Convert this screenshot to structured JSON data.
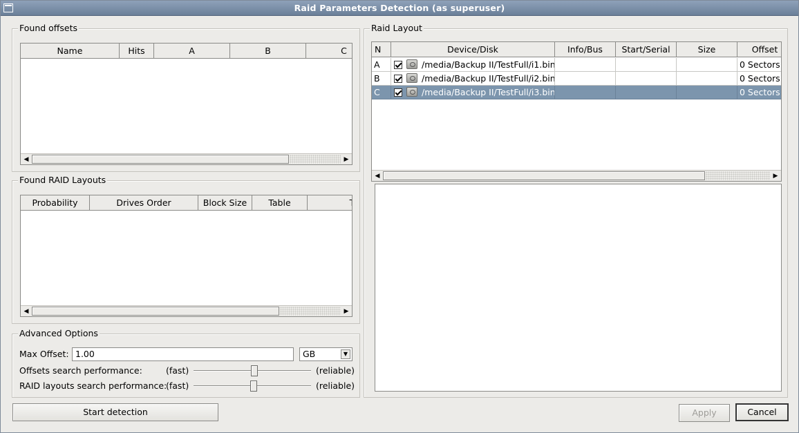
{
  "window": {
    "title": "Raid Parameters Detection (as superuser)"
  },
  "found_offsets": {
    "title": "Found offsets",
    "columns": [
      "Name",
      "Hits",
      "A",
      "B",
      "C"
    ]
  },
  "found_layouts": {
    "title": "Found RAID Layouts",
    "columns": [
      "Probability",
      "Drives Order",
      "Block Size",
      "Table",
      "T"
    ]
  },
  "advanced": {
    "title": "Advanced Options",
    "max_offset_label": "Max Offset:",
    "max_offset_value": "1.00",
    "unit": "GB",
    "offsets_perf_label": "Offsets search performance:",
    "layouts_perf_label": "RAID layouts search performance:",
    "fast_label": "(fast)",
    "reliable_label": "(reliable)",
    "offsets_perf_level": 0.52,
    "layouts_perf_level": 0.51
  },
  "raid_layout": {
    "title": "Raid Layout",
    "columns": [
      "N",
      "Device/Disk",
      "Info/Bus",
      "Start/Serial",
      "Size",
      "Offset"
    ],
    "rows": [
      {
        "n": "A",
        "checked": true,
        "device": "/media/Backup II/TestFull/i1.bin",
        "info": "",
        "start": "",
        "size": "",
        "offset": "0 Sectors",
        "selected": false
      },
      {
        "n": "B",
        "checked": true,
        "device": "/media/Backup II/TestFull/i2.bin",
        "info": "",
        "start": "",
        "size": "",
        "offset": "0 Sectors",
        "selected": false
      },
      {
        "n": "C",
        "checked": true,
        "device": "/media/Backup II/TestFull/i3.bin",
        "info": "",
        "start": "",
        "size": "",
        "offset": "0 Sectors",
        "selected": true
      }
    ]
  },
  "buttons": {
    "start_detection": "Start detection",
    "apply": "Apply",
    "cancel": "Cancel"
  }
}
